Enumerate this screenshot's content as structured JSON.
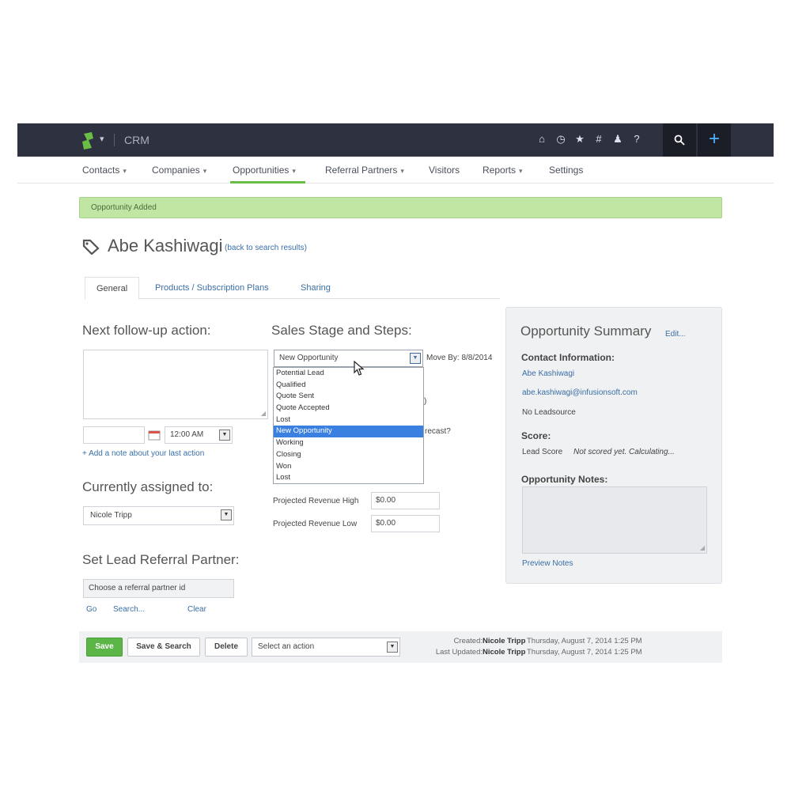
{
  "header": {
    "app_name": "CRM",
    "top_icons": [
      "home-icon",
      "clock-icon",
      "star-icon",
      "hash-icon",
      "user-icon",
      "help-icon"
    ],
    "search_icon": "search-icon",
    "add_icon": "plus-icon",
    "accent": "#6abd45"
  },
  "nav": {
    "items": [
      {
        "label": "Contacts",
        "has_caret": true
      },
      {
        "label": "Companies",
        "has_caret": true
      },
      {
        "label": "Opportunities",
        "has_caret": true,
        "active": true
      },
      {
        "label": "Referral Partners",
        "has_caret": true
      },
      {
        "label": "Visitors",
        "has_caret": false
      },
      {
        "label": "Reports",
        "has_caret": true
      },
      {
        "label": "Settings",
        "has_caret": false
      }
    ]
  },
  "alert": {
    "text": "Opportunity Added"
  },
  "record": {
    "title": "Abe Kashiwagi",
    "back_link": "(back to search results)"
  },
  "tabs": [
    {
      "label": "General",
      "active": true
    },
    {
      "label": "Products / Subscription Plans"
    },
    {
      "label": "Sharing"
    }
  ],
  "followup": {
    "heading": "Next follow-up action:",
    "time": "12:00 AM",
    "add_note": "+ Add a note about your last action"
  },
  "assigned": {
    "heading": "Currently assigned to:",
    "value": "Nicole Tripp"
  },
  "referral": {
    "heading": "Set Lead Referral Partner:",
    "placeholder": "Choose a referral partner id",
    "go": "Go",
    "search": "Search...",
    "clear": "Clear"
  },
  "stage": {
    "heading": "Sales Stage and Steps:",
    "selected": "New Opportunity",
    "move_by": "Move By: 8/8/2014",
    "options": [
      "Potential Lead",
      "Qualified",
      "Quote Sent",
      "Quote Accepted",
      "Lost",
      "New Opportunity",
      "Working",
      "Closing",
      "Won",
      "Lost"
    ],
    "selected_index": 5,
    "forecast_fragment": "recast?",
    "projected_high_label": "Projected Revenue High",
    "projected_high_value": "$0.00",
    "projected_low_label": "Projected Revenue Low",
    "projected_low_value": "$0.00"
  },
  "summary": {
    "title": "Opportunity Summary",
    "edit": "Edit...",
    "contact_heading": "Contact Information:",
    "contact_name": "Abe Kashiwagi",
    "contact_email": "abe.kashiwagi@infusionsoft.com",
    "leadsource": "No Leadsource",
    "score_heading": "Score:",
    "lead_score_label": "Lead Score",
    "lead_score_value": "Not scored yet. Calculating...",
    "notes_heading": "Opportunity Notes:",
    "preview_notes": "Preview Notes"
  },
  "footer": {
    "save": "Save",
    "save_search": "Save & Search",
    "delete": "Delete",
    "action_placeholder": "Select an action",
    "created_label": "Created:",
    "created_by": "Nicole Tripp",
    "created_date": "Thursday, August 7, 2014 1:25 PM",
    "updated_label": "Last Updated:",
    "updated_by": "Nicole Tripp",
    "updated_date": "Thursday, August 7, 2014 1:25 PM"
  }
}
